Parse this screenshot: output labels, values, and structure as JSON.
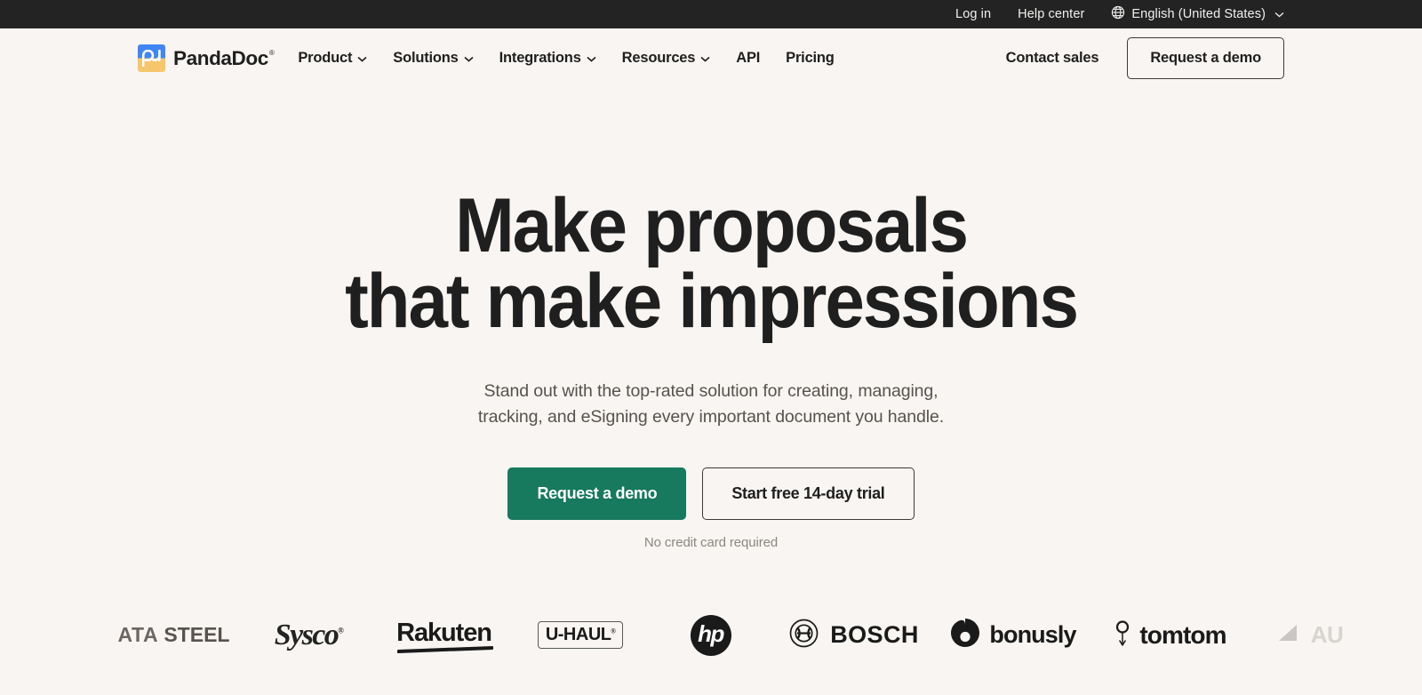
{
  "topbar": {
    "login": "Log in",
    "help_center": "Help center",
    "language": "English (United States)",
    "globe_icon": "globe-icon",
    "chevron_icon": "chevron-down-icon",
    "background_color": "#232323",
    "text_color": "#f2f0ee"
  },
  "nav": {
    "brand": "PandaDoc",
    "brand_trademark": "®",
    "logo_icon": "pandadoc-logo-icon",
    "logo_colors": {
      "top": "#4285f4",
      "bottom": "#f5c66b",
      "glyph": "#ffffff"
    },
    "items": [
      {
        "label": "Product",
        "has_dropdown": true
      },
      {
        "label": "Solutions",
        "has_dropdown": true
      },
      {
        "label": "Integrations",
        "has_dropdown": true
      },
      {
        "label": "Resources",
        "has_dropdown": true
      },
      {
        "label": "API",
        "has_dropdown": false
      },
      {
        "label": "Pricing",
        "has_dropdown": false
      }
    ],
    "contact_sales": "Contact sales",
    "request_demo": "Request a demo"
  },
  "hero": {
    "headline_line1": "Make proposals",
    "headline_line2": "that make impressions",
    "subhead_line1": "Stand out with the top-rated solution for creating, managing,",
    "subhead_line2": "tracking, and eSigning every important document you handle.",
    "primary_cta": "Request a demo",
    "secondary_cta": "Start free 14-day trial",
    "note": "No credit card required",
    "primary_color": "#17795e",
    "heading_color": "#1f1f1f",
    "background_color": "#f8f5f2"
  },
  "logos": {
    "items": [
      {
        "name": "tata-steel",
        "text_light": "ATA",
        "text_bold": "STEEL",
        "cut_off": true
      },
      {
        "name": "sysco",
        "text": "Sysco"
      },
      {
        "name": "rakuten",
        "text": "Rakuten"
      },
      {
        "name": "u-haul",
        "text": "U-HAUL"
      },
      {
        "name": "hp",
        "text": "hp"
      },
      {
        "name": "bosch",
        "text": "BOSCH"
      },
      {
        "name": "bonusly",
        "text": "bonusly"
      },
      {
        "name": "tomtom",
        "text": "tomtom"
      },
      {
        "name": "partial-logo",
        "text": "AU",
        "cut_off": true
      }
    ]
  }
}
